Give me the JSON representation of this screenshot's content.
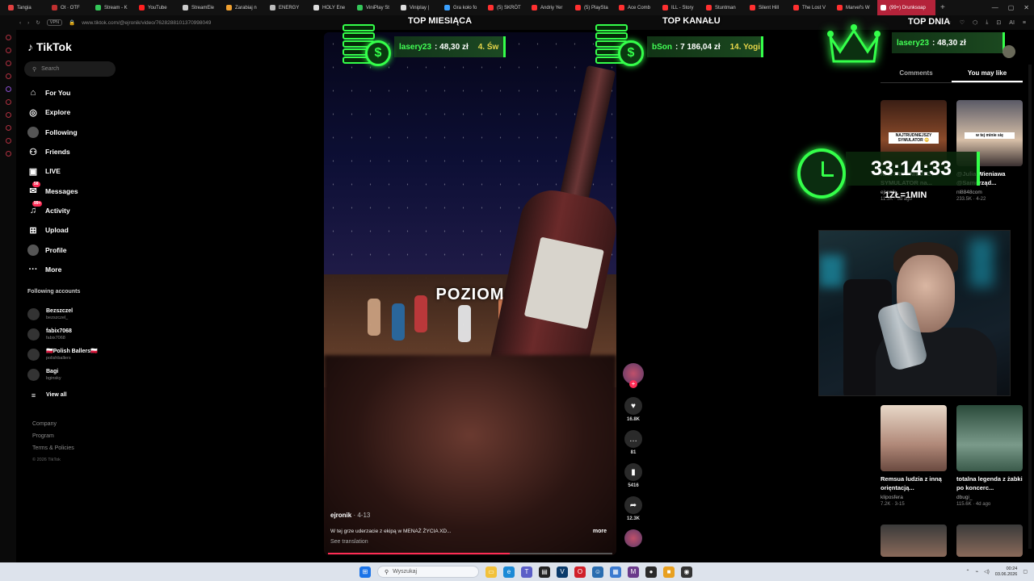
{
  "browser": {
    "tabs": [
      {
        "label": "Tangia",
        "color": "#e04040"
      },
      {
        "label": "Ot · OTF",
        "color": "#c03030"
      },
      {
        "label": "Stream - K",
        "color": "#34c759"
      },
      {
        "label": "YouTube",
        "color": "#ff2020"
      },
      {
        "label": "StreamEle",
        "color": "#cccccc"
      },
      {
        "label": "Zarabiaj n",
        "color": "#f0a030"
      },
      {
        "label": "ENERGY",
        "color": "#bbbbbb"
      },
      {
        "label": "HOLY Ene",
        "color": "#dddddd"
      },
      {
        "label": "ViniPlay St",
        "color": "#34c759"
      },
      {
        "label": "Viniplay |",
        "color": "#dddddd"
      },
      {
        "label": "Gra koło fo",
        "color": "#3aa0ff"
      },
      {
        "label": "(5) SKRÓT",
        "color": "#ff3030"
      },
      {
        "label": "Andriy Yer",
        "color": "#ff3030"
      },
      {
        "label": "(5) PlaySta",
        "color": "#ff3030"
      },
      {
        "label": "Ace Comb",
        "color": "#ff3030"
      },
      {
        "label": "ILL - Story",
        "color": "#ff3030"
      },
      {
        "label": "Stuntman",
        "color": "#ff3030"
      },
      {
        "label": "Silent Hill",
        "color": "#ff3030"
      },
      {
        "label": "The Lost V",
        "color": "#ff3030"
      },
      {
        "label": "Marvel's W",
        "color": "#ff3030"
      }
    ],
    "active_tab": "(99+) Drunksoap",
    "url": "www.tiktok.com/@ejronik/video/7628288101370998049",
    "vpn_label": "VPN",
    "ai_label": "AI"
  },
  "sidebar": {
    "logo": "TikTok",
    "search_placeholder": "Search",
    "nav": [
      {
        "label": "For You",
        "icon": "home-icon",
        "glyph": "⌂"
      },
      {
        "label": "Explore",
        "icon": "compass-icon",
        "glyph": "◎"
      },
      {
        "label": "Following",
        "icon": "following-avatar-icon",
        "glyph": ""
      },
      {
        "label": "Friends",
        "icon": "friends-icon",
        "glyph": "⚇"
      },
      {
        "label": "LIVE",
        "icon": "live-icon",
        "glyph": "▣"
      },
      {
        "label": "Messages",
        "icon": "messages-icon",
        "glyph": "✉",
        "badge": "58"
      },
      {
        "label": "Activity",
        "icon": "activity-icon",
        "glyph": "♫",
        "badge": "99+"
      },
      {
        "label": "Upload",
        "icon": "upload-icon",
        "glyph": "⊞"
      },
      {
        "label": "Profile",
        "icon": "profile-avatar-icon",
        "glyph": ""
      },
      {
        "label": "More",
        "icon": "more-icon",
        "glyph": "···"
      }
    ],
    "following_heading": "Following accounts",
    "following": [
      {
        "name": "Bezszczel",
        "handle": "bezszczel_"
      },
      {
        "name": "fabix7068",
        "handle": "fabix7068"
      },
      {
        "name": "🇵🇱Polish Ballers🇵🇱",
        "handle": "polishballers"
      },
      {
        "name": "Bagi",
        "handle": "bginsky"
      }
    ],
    "view_all": "View all",
    "footer": [
      "Company",
      "Program",
      "Terms & Policies"
    ],
    "copyright": "© 2026 TikTok"
  },
  "video": {
    "caption_overlay": "POZIOM",
    "author": "ejronik",
    "date": "4-13",
    "description": "W tej grze uderzacie z ekipą w MENAŻ ŻYCIA XD...",
    "more": "more",
    "see_translation": "See translation",
    "progress": 0.64
  },
  "actions": {
    "likes": "16.8K",
    "comments": "81",
    "saves": "5416",
    "shares": "12.3K"
  },
  "overlays": {
    "top_month": {
      "title": "TOP MIESIĄCA",
      "name": "lasery23",
      "amount": ": 48,30 zł",
      "next": "4. Św"
    },
    "top_channel": {
      "title": "TOP KANAŁU",
      "name": "bSon",
      "amount": ": 7 186,04 zł",
      "next": "14. Yogi"
    },
    "top_day": {
      "title": "TOP DNIA",
      "name": "lasery23",
      "amount": ": 48,30 zł"
    },
    "timer": "33:14:33",
    "rate": "1ZŁ=1MIN"
  },
  "right_panel": {
    "tabs": [
      "Comments",
      "You may like"
    ],
    "active_tab": "You may like",
    "cards": [
      {
        "title": "NAJTRUDNIEJSZY SYMULATOR na...",
        "author": "ejronik",
        "stats": "11.3K · 5d ago",
        "thumb_text": "NAJTRUDNIEJSZY SYMULATOR 😳"
      },
      {
        "title": "@Julia Wieniawa @Samorząd...",
        "author": "nl8848com",
        "stats": "233.5K · 4-22",
        "thumb_text": "w tej minie się"
      },
      {
        "title": "Remsua ludzia z inną orięntacją...",
        "author": "klipos​fera",
        "stats": "7.2K · 3-15",
        "thumb_text": ""
      },
      {
        "title": "totalna legenda z żabki po koncerc...",
        "author": "dbugi_",
        "stats": "115.6K · 4d ago",
        "thumb_text": ""
      }
    ]
  },
  "taskbar": {
    "search_placeholder": "Wyszukaj",
    "time": "00:24",
    "date": "03.06.2026"
  }
}
